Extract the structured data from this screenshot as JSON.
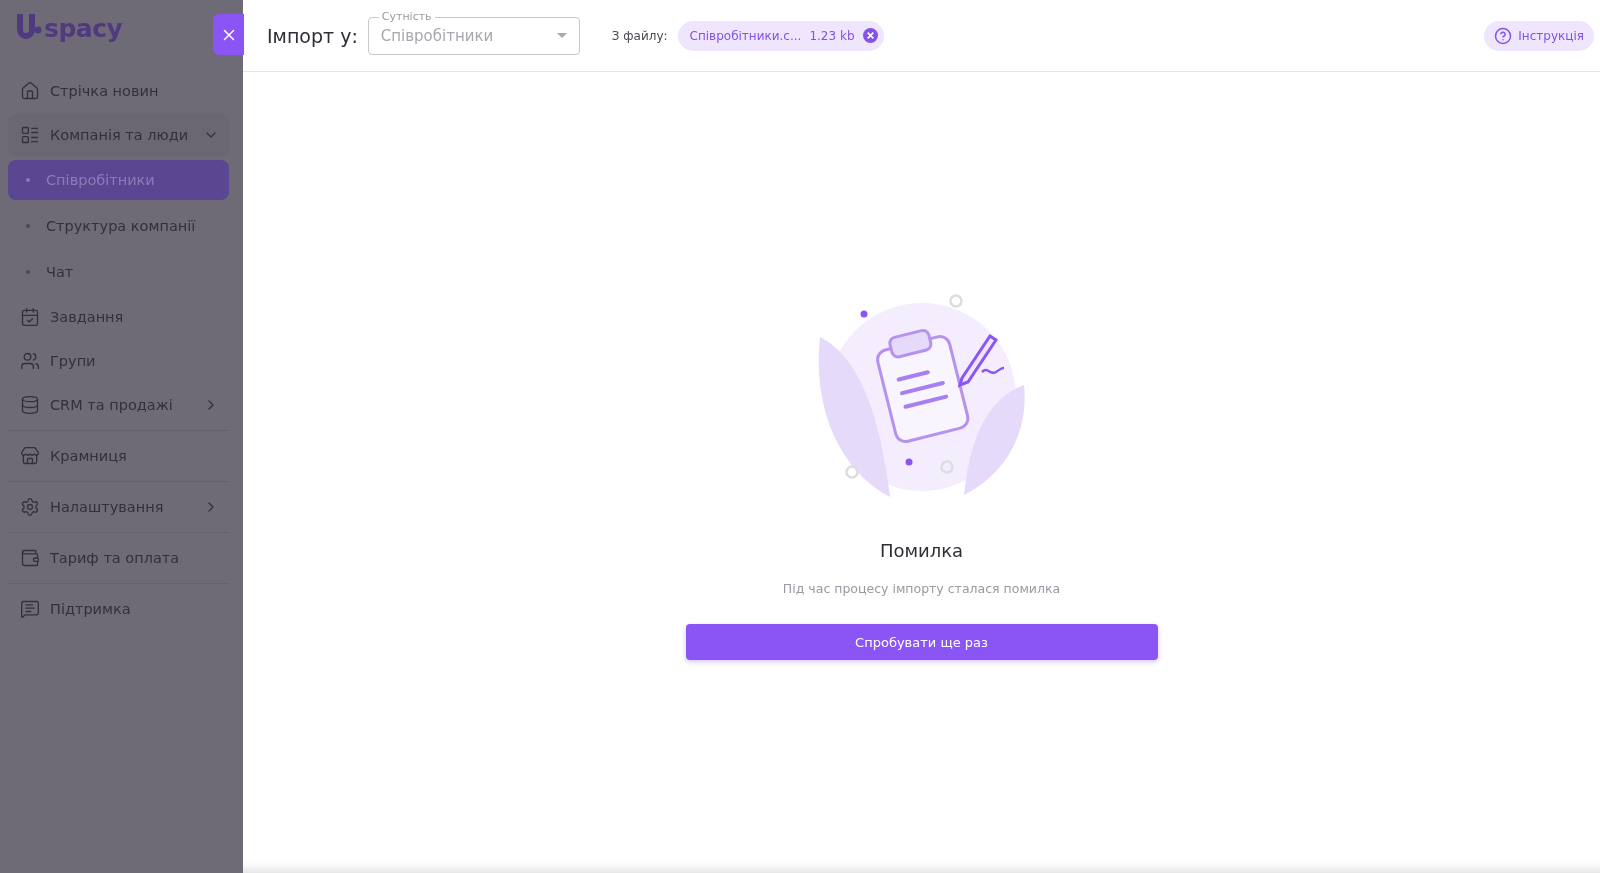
{
  "sidebar": {
    "logo": "spacy",
    "sections": [
      [
        {
          "label": "Стрічка новин"
        },
        {
          "label": "Компанія та люди",
          "expanded": true,
          "children": [
            {
              "label": "Співробітники",
              "selected": true
            },
            {
              "label": "Структура компанії",
              "selected": false
            },
            {
              "label": "Чат",
              "selected": false
            }
          ]
        },
        {
          "label": "Завдання"
        },
        {
          "label": "Групи"
        },
        {
          "label": "CRM та продажі",
          "expanded": false
        }
      ],
      [
        {
          "label": "Крамниця"
        }
      ],
      [
        {
          "label": "Налаштування",
          "expanded": false
        }
      ],
      [
        {
          "label": "Тариф та оплата"
        }
      ],
      [
        {
          "label": "Підтримка"
        }
      ]
    ]
  },
  "header": {
    "title": "Імпорт у:",
    "entity": {
      "label": "Сутність",
      "value": "Співробітники",
      "disabled": true
    },
    "file_label": "З файлу:",
    "file": {
      "name": "Співробітники.c...",
      "size": "1.23 kb"
    },
    "help": "Інструкція"
  },
  "error": {
    "title": "Помилка",
    "message": "Під час процесу імпорту сталася помилка",
    "button": "Спробувати ще раз"
  }
}
